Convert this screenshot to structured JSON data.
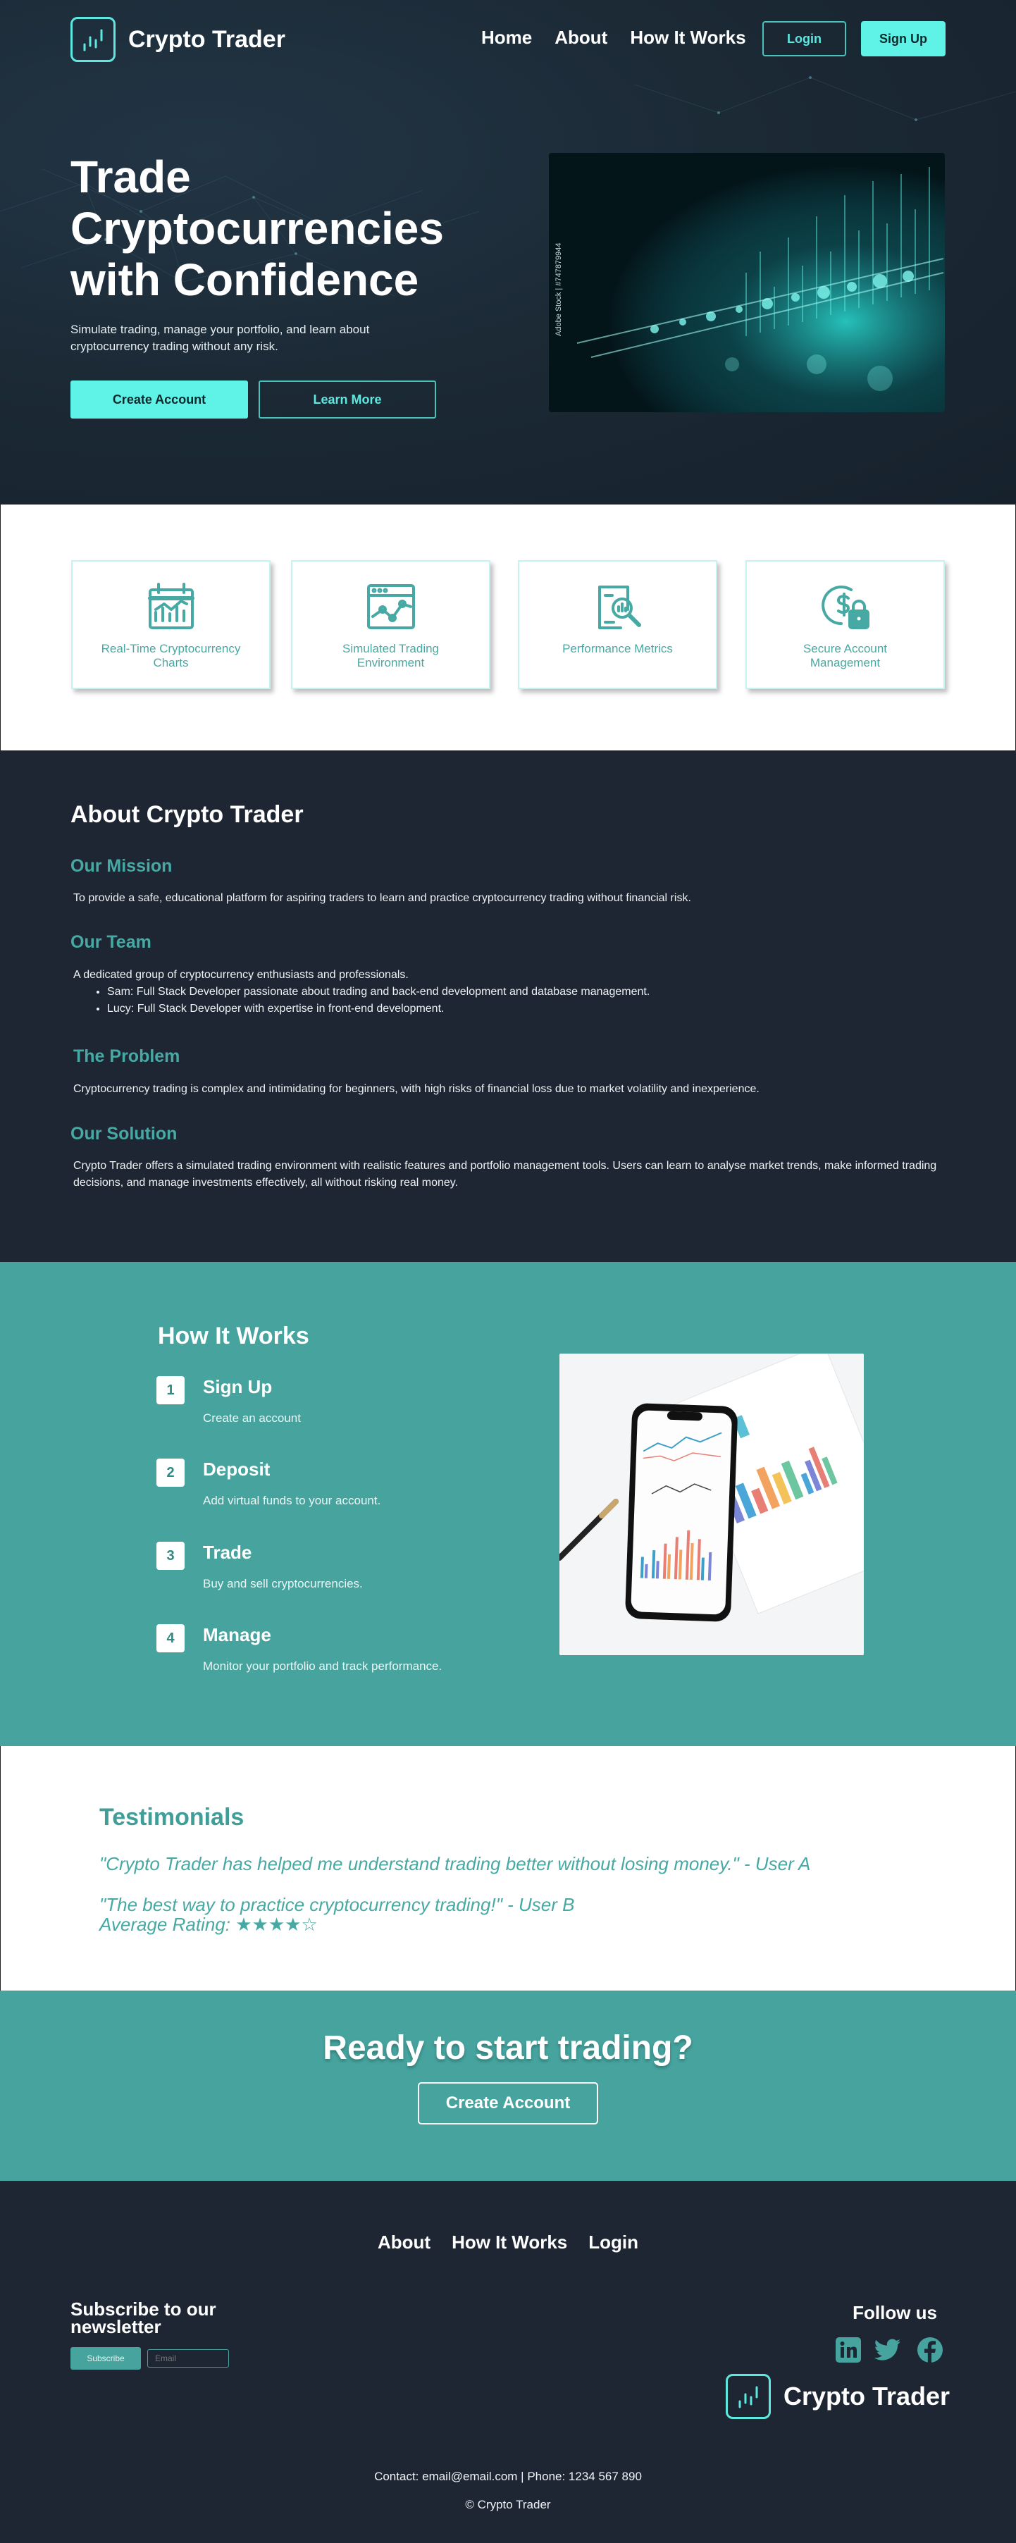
{
  "brand": {
    "name": "Crypto Trader"
  },
  "nav": {
    "links": [
      "Home",
      "About",
      "How It Works"
    ],
    "login": "Login",
    "signup": "Sign Up"
  },
  "hero": {
    "title": "Trade Cryptocurrencies with Confidence",
    "subtitle": "Simulate trading, manage your portfolio, and learn about cryptocurrency trading without any risk.",
    "create_account": "Create Account",
    "learn_more": "Learn More",
    "image_credit": "Adobe Stock | #747879944"
  },
  "features": [
    {
      "label": "Real-Time Cryptocurrency Charts",
      "icon": "calendar-chart-icon"
    },
    {
      "label": "Simulated Trading Environment",
      "icon": "browser-chart-icon"
    },
    {
      "label": "Performance Metrics",
      "icon": "report-search-icon"
    },
    {
      "label": "Secure Account Management",
      "icon": "dollar-lock-icon"
    }
  ],
  "about": {
    "title": "About Crypto Trader",
    "mission_title": "Our Mission",
    "mission_text": "To provide a safe, educational platform for aspiring traders to learn and practice cryptocurrency trading without financial risk.",
    "team_title": "Our Team",
    "team_text": "A dedicated group of cryptocurrency enthusiasts and professionals.",
    "team_members": [
      "Sam: Full Stack Developer passionate about trading and back-end development and database management.",
      "Lucy: Full Stack Developer with expertise in front-end development."
    ],
    "problem_title": "The Problem",
    "problem_text": "Cryptocurrency trading is complex and intimidating for beginners, with high risks of financial loss due to market volatility and inexperience.",
    "solution_title": "Our Solution",
    "solution_text": "Crypto Trader offers a simulated trading environment with realistic features and portfolio management tools. Users can learn to analyse market trends, make informed trading decisions, and manage investments effectively, all without risking real money."
  },
  "how": {
    "title": "How It Works",
    "steps": [
      {
        "num": "1",
        "title": "Sign Up",
        "desc": "Create an account"
      },
      {
        "num": "2",
        "title": "Deposit",
        "desc": "Add virtual funds to your account."
      },
      {
        "num": "3",
        "title": "Trade",
        "desc": "Buy and sell cryptocurrencies."
      },
      {
        "num": "4",
        "title": "Manage",
        "desc": "Monitor your portfolio and track performance."
      }
    ]
  },
  "testimonials": {
    "title": "Testimonials",
    "quotes": [
      "\"Crypto Trader has helped me understand trading better without losing money.\" - User A",
      "\"The best way to practice cryptocurrency trading!\" - User B"
    ],
    "rating_label": "Average Rating: ★★★★☆",
    "rating_value": 4,
    "rating_max": 5
  },
  "cta": {
    "title": "Ready to start trading?",
    "button": "Create Account"
  },
  "footer": {
    "links": [
      "About",
      "How It Works",
      "Login"
    ],
    "subscribe_title": "Subscribe to our newsletter",
    "subscribe_button": "Subscribe",
    "email_placeholder": "Email",
    "follow_title": "Follow us",
    "social": [
      "linkedin-icon",
      "twitter-icon",
      "facebook-icon"
    ],
    "contact": "Contact: email@email.com | Phone: 1234 567 890",
    "copyright": "© Crypto Trader"
  },
  "colors": {
    "accent": "#5ff2e6",
    "teal": "#46a39e",
    "dark": "#1f2633"
  }
}
